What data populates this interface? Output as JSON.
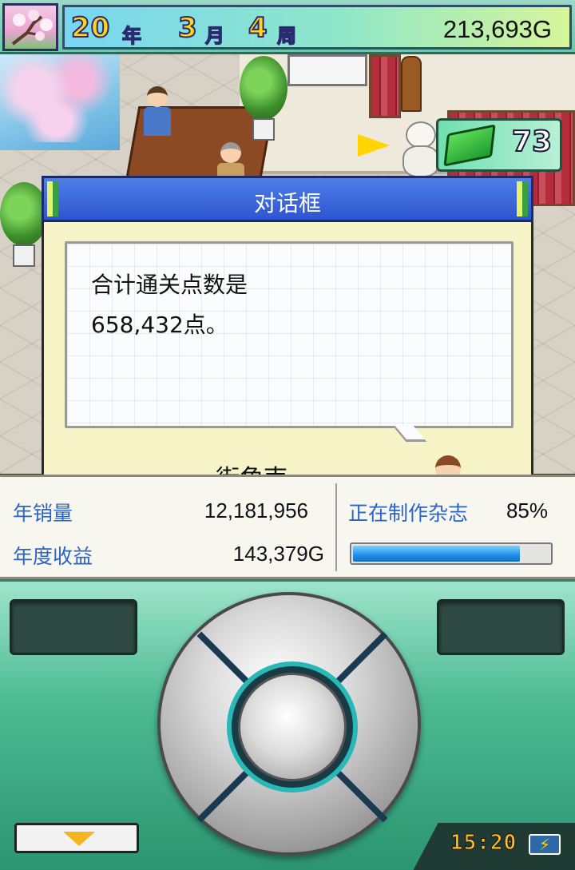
{
  "header": {
    "year_value": "20",
    "year_unit": "年",
    "month_value": "3",
    "month_unit": "月",
    "week_value": "4",
    "week_unit": "周",
    "money": "213,693G",
    "season_icon": "cherry-blossom-icon"
  },
  "scene": {
    "book_count": "73",
    "book_icon": "green-book-icon"
  },
  "dialog": {
    "title": "对话框",
    "line1": "合计通关点数是",
    "line2": "658,432点。",
    "speaker": "街角南"
  },
  "stats": {
    "annual_sales_label": "年销量",
    "annual_sales_value": "12,181,956",
    "annual_revenue_label": "年度收益",
    "annual_revenue_value": "143,379G",
    "production_label": "正在制作杂志",
    "production_percent": "85%",
    "production_progress": 0.85
  },
  "controller": {
    "clock": "15:20",
    "battery_icon": "battery-charging-icon",
    "menu_icon": "chevron-down-icon"
  },
  "colors": {
    "accent_blue": "#2e55d0",
    "label_blue": "#2b63c9",
    "progress_blue": "#1f8ee8",
    "pad_green": "#4fbc96",
    "digit_yellow": "#ffd41a"
  }
}
